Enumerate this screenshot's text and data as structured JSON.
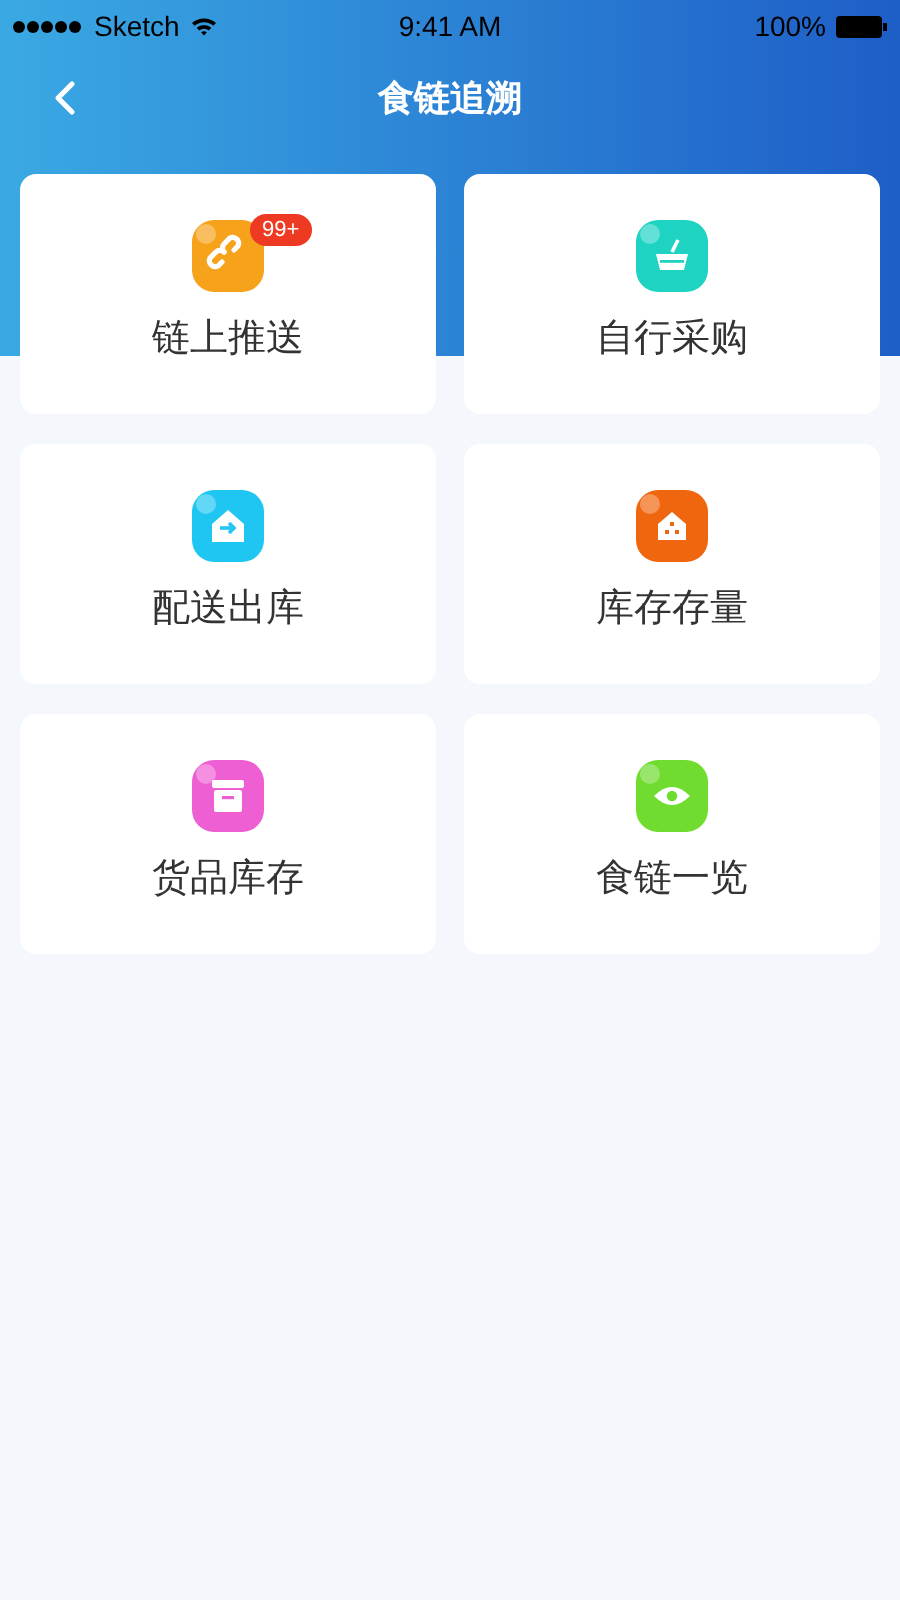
{
  "status_bar": {
    "carrier": "Sketch",
    "time": "9:41 AM",
    "battery": "100%"
  },
  "nav": {
    "title": "食链追溯"
  },
  "tiles": [
    {
      "label": "链上推送",
      "kind": "link",
      "color": "#f7a21b",
      "badge": "99+"
    },
    {
      "label": "自行采购",
      "kind": "basket",
      "color": "#1fd3c3"
    },
    {
      "label": "配送出库",
      "kind": "delivery",
      "color": "#1fc6f2"
    },
    {
      "label": "库存存量",
      "kind": "house",
      "color": "#f0660f"
    },
    {
      "label": "货品库存",
      "kind": "box",
      "color": "#ef5fd4"
    },
    {
      "label": "食链一览",
      "kind": "eye",
      "color": "#6fdc2f"
    }
  ]
}
